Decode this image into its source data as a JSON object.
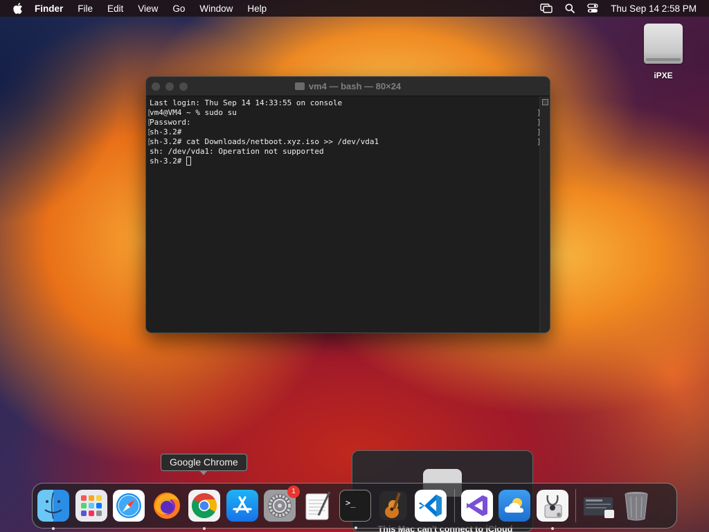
{
  "menubar": {
    "app_name": "Finder",
    "items": [
      "File",
      "Edit",
      "View",
      "Go",
      "Window",
      "Help"
    ],
    "clock": "Thu Sep 14  2:58 PM"
  },
  "desktop": {
    "icons": [
      {
        "label": "iPXE",
        "icon": "external-disk-icon"
      }
    ]
  },
  "terminal": {
    "title": "vm4 — bash — 80×24",
    "lines": [
      "Last login: Thu Sep 14 14:33:55 on console",
      "vm4@VM4 ~ % sudo su",
      "Password:",
      "sh-3.2#",
      "sh-3.2# cat Downloads/netboot.xyz.iso >> /dev/vda1",
      "sh: /dev/vda1: Operation not supported",
      "sh-3.2# "
    ]
  },
  "tooltip": {
    "text": "Google Chrome"
  },
  "notification": {
    "text": "This Mac can't connect to iCloud"
  },
  "dock": {
    "apps": [
      {
        "name": "Finder",
        "icon": "finder-icon",
        "running": true
      },
      {
        "name": "Launchpad",
        "icon": "launchpad-icon",
        "running": false
      },
      {
        "name": "Safari",
        "icon": "safari-icon",
        "running": false
      },
      {
        "name": "Firefox",
        "icon": "firefox-icon",
        "running": false
      },
      {
        "name": "Google Chrome",
        "icon": "chrome-icon",
        "running": true
      },
      {
        "name": "App Store",
        "icon": "app-store-icon",
        "running": false
      },
      {
        "name": "System Settings",
        "icon": "settings-icon",
        "running": false,
        "badge": "1"
      },
      {
        "name": "TextEdit",
        "icon": "textedit-icon",
        "running": false
      },
      {
        "name": "Terminal",
        "icon": "terminal-icon",
        "running": true
      },
      {
        "name": "GarageBand",
        "icon": "garageband-icon",
        "running": false
      },
      {
        "name": "Visual Studio Code",
        "icon": "vscode-icon",
        "running": false
      },
      {
        "name": "Visual Studio",
        "icon": "visual-studio-icon",
        "running": false
      },
      {
        "name": "Weather",
        "icon": "weather-icon",
        "running": false
      },
      {
        "name": "Disk Utility",
        "icon": "disk-utility-icon",
        "running": true
      },
      {
        "name": "Downloads",
        "icon": "downloads-stack-icon",
        "running": false
      },
      {
        "name": "Trash",
        "icon": "trash-icon",
        "running": false
      }
    ]
  },
  "colors": {
    "accent_orange": "#f08820",
    "badge_red": "#e8362f",
    "terminal_bg": "#1e1e1e"
  }
}
